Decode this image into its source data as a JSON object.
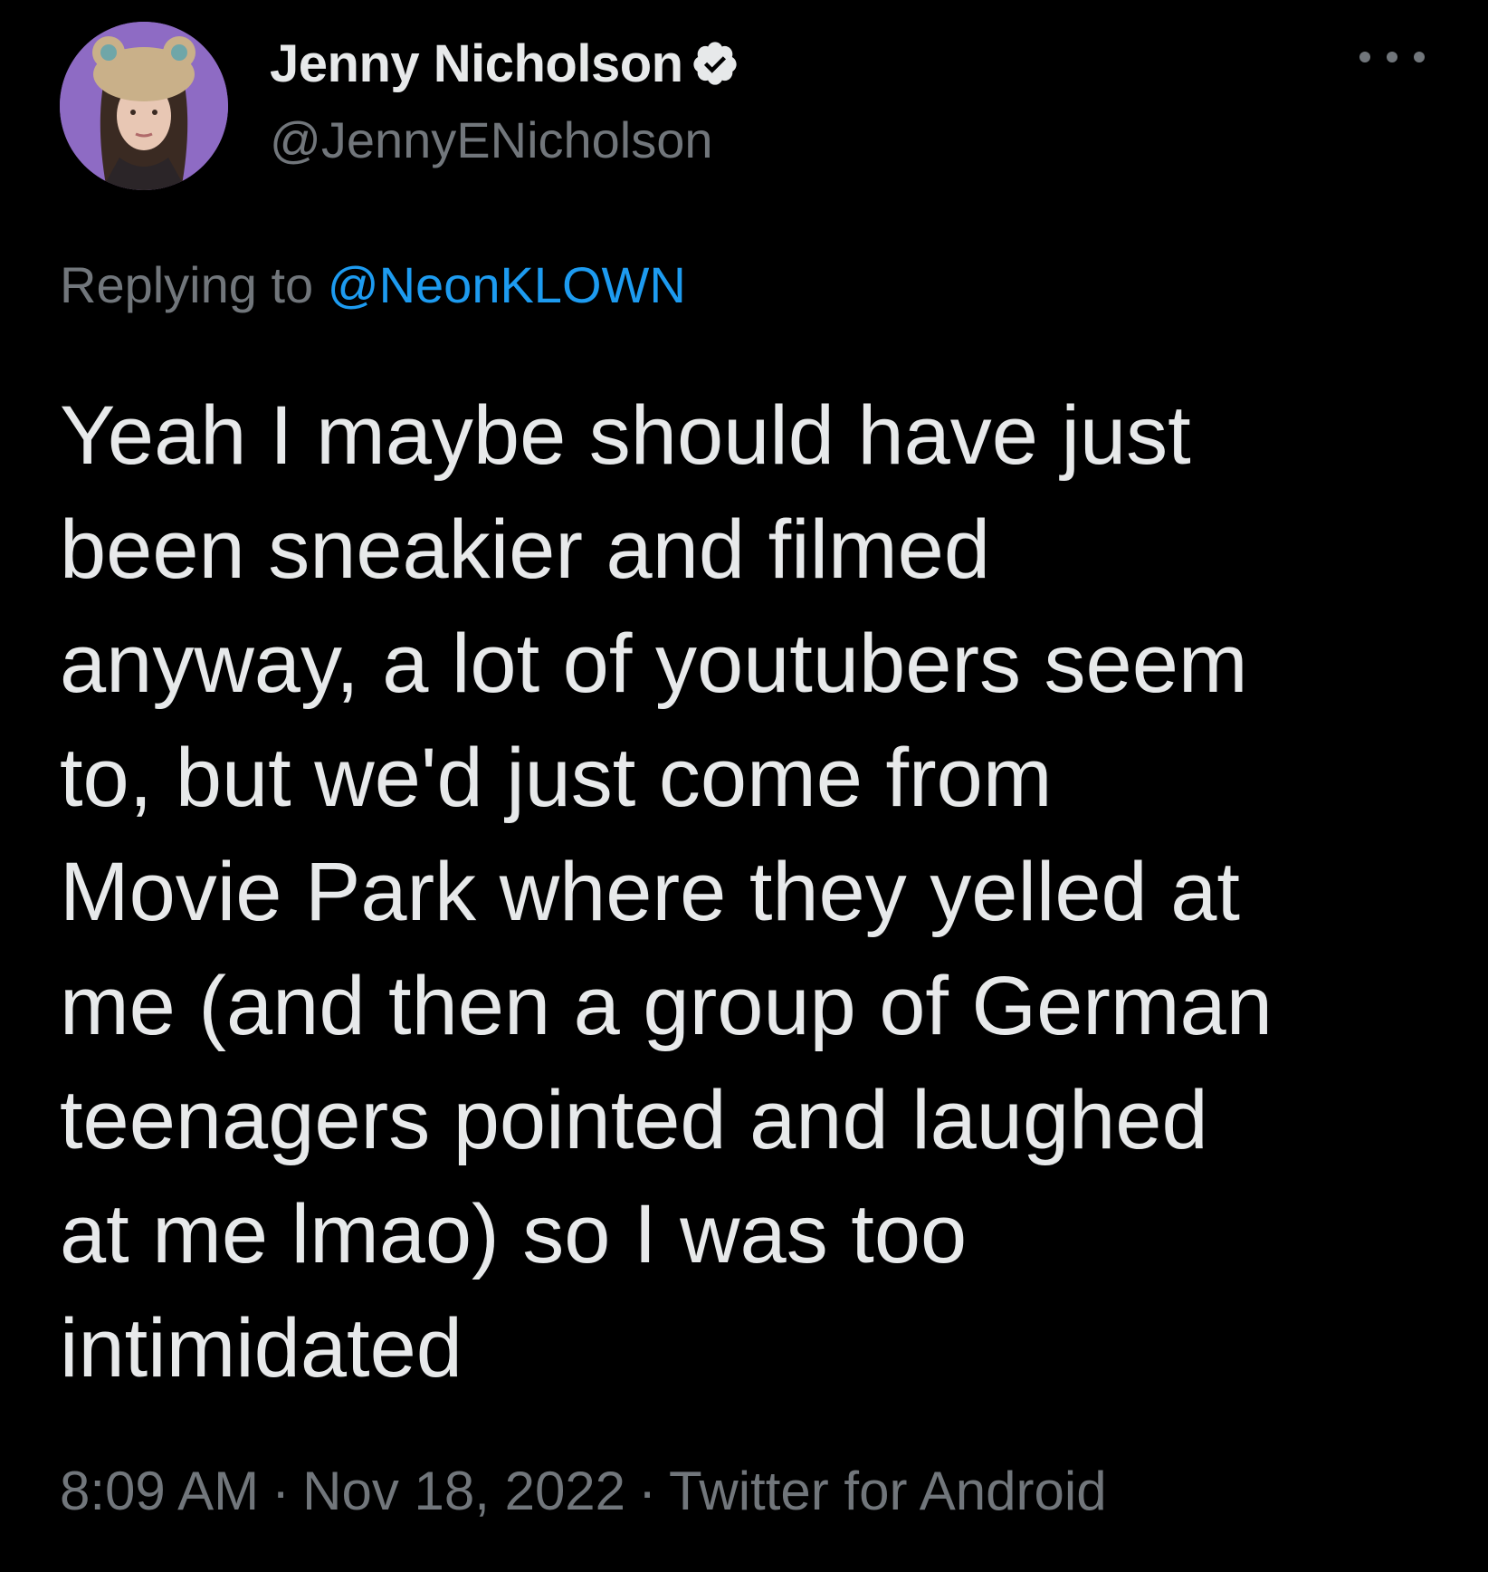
{
  "tweet": {
    "author": {
      "display_name": "Jenny Nicholson",
      "handle": "@JennyENicholson",
      "verified": true,
      "avatar_icon": "profile-avatar"
    },
    "more_icon": "more-options-icon",
    "reply_prefix": "Replying to",
    "reply_mention": "@NeonKLOWN",
    "text_lines": [
      "Yeah I maybe should have just",
      "been sneakier and filmed",
      "anyway, a lot of youtubers seem",
      "to, but we'd just come from",
      "Movie Park where they yelled at",
      "me (and then a group of German",
      "teenagers pointed and laughed",
      "at me lmao) so I was too",
      "intimidated"
    ],
    "time": "8:09 AM",
    "date": "Nov 18, 2022",
    "source": "Twitter for Android",
    "separator": "·"
  },
  "colors": {
    "background": "#000000",
    "primary_text": "#e7e9ea",
    "secondary_text": "#71767b",
    "link": "#1d9bf0",
    "avatar_bg": "#8e6bc4"
  }
}
